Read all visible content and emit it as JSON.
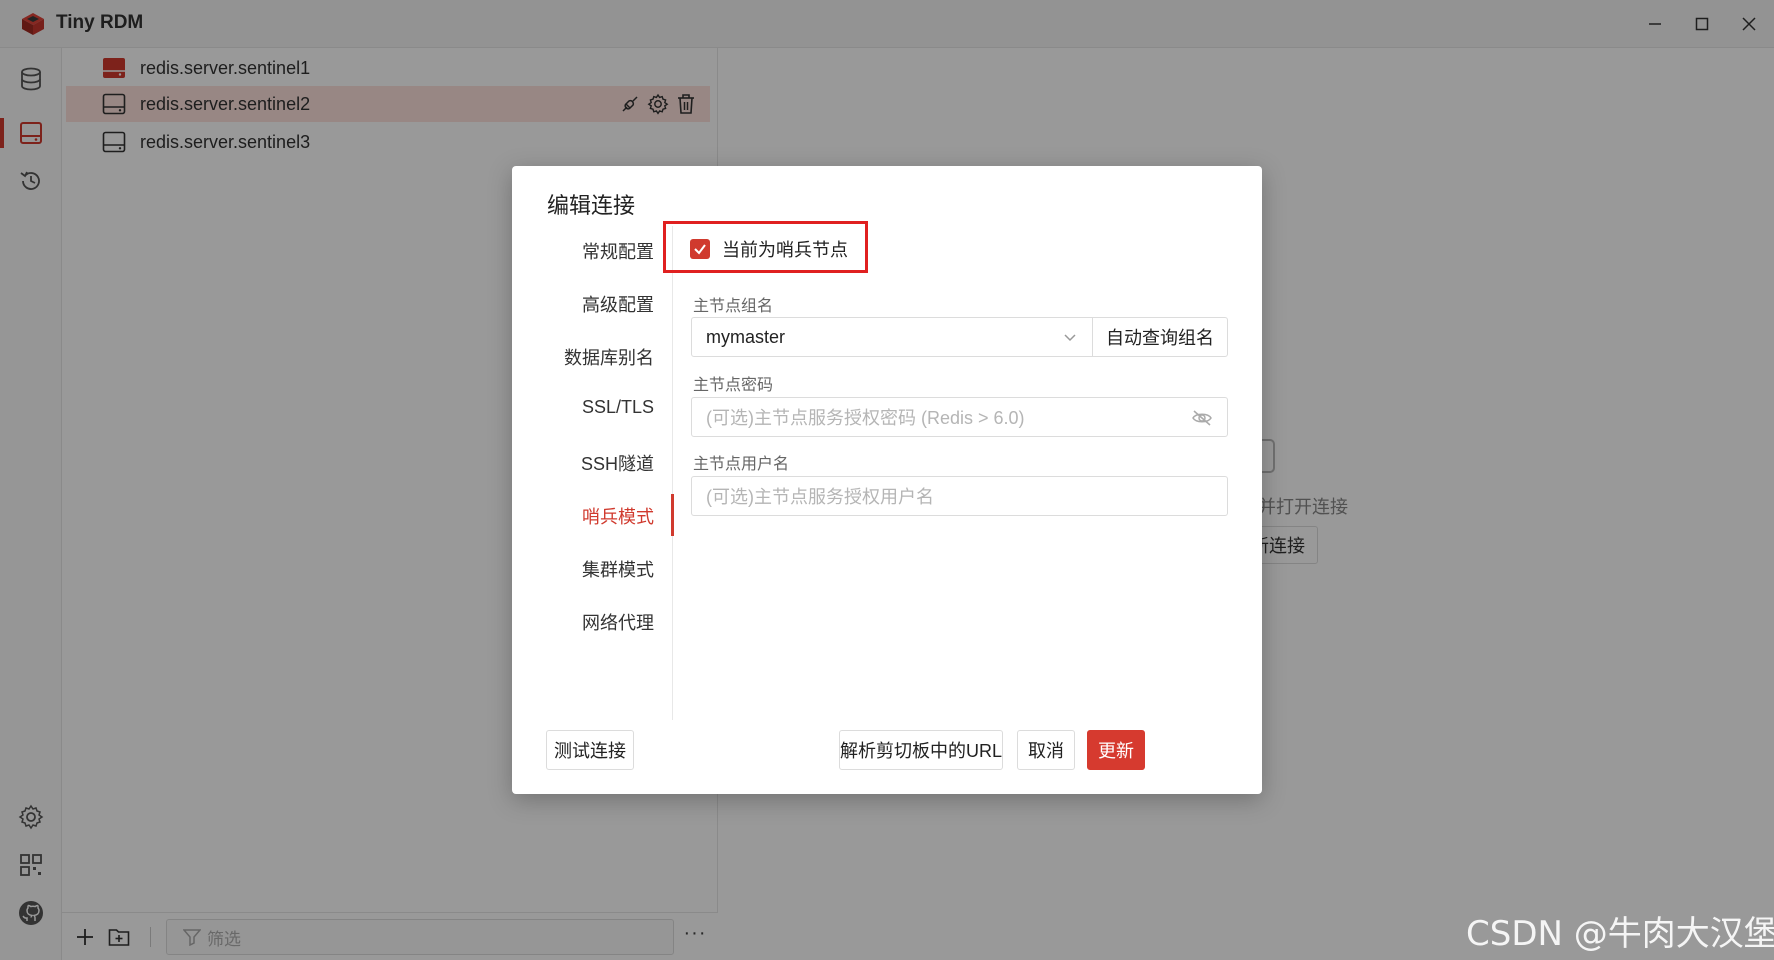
{
  "window": {
    "title": "Tiny RDM"
  },
  "colors": {
    "accent": "#d63a2f",
    "highlight_border": "#e02020"
  },
  "sidebar_icons": [
    "database-icon",
    "server-icon",
    "history-icon",
    "settings-icon",
    "apps-icon",
    "github-icon"
  ],
  "connections": [
    {
      "label": "redis.server.sentinel1",
      "status": "connected"
    },
    {
      "label": "redis.server.sentinel2",
      "status": "selected"
    },
    {
      "label": "redis.server.sentinel3",
      "status": "idle"
    }
  ],
  "filter": {
    "placeholder": "筛选"
  },
  "main": {
    "hint": "并打开连接",
    "button": "新连接"
  },
  "dialog": {
    "title": "编辑连接",
    "tabs": [
      "常规配置",
      "高级配置",
      "数据库别名",
      "SSL/TLS",
      "SSH隧道",
      "哨兵模式",
      "集群模式",
      "网络代理"
    ],
    "active_tab": "哨兵模式",
    "sentinel_checkbox": {
      "label": "当前为哨兵节点",
      "checked": true
    },
    "master_group": {
      "label": "主节点组名",
      "value": "mymaster",
      "auto_button": "自动查询组名"
    },
    "master_password": {
      "label": "主节点密码",
      "placeholder": "(可选)主节点服务授权密码 (Redis > 6.0)"
    },
    "master_username": {
      "label": "主节点用户名",
      "placeholder": "(可选)主节点服务授权用户名"
    },
    "buttons": {
      "test": "测试连接",
      "parse_url": "解析剪切板中的URL",
      "cancel": "取消",
      "update": "更新"
    }
  },
  "watermark": "CSDN @牛肉大汉堡"
}
